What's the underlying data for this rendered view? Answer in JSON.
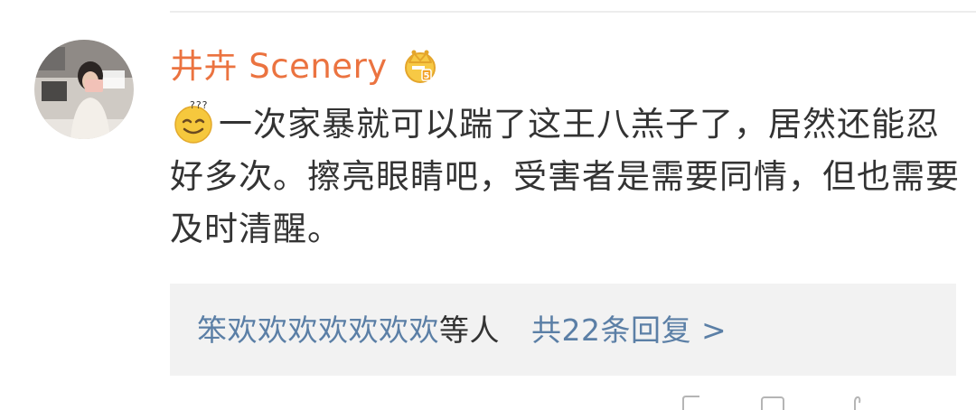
{
  "comment": {
    "username": "井卉 Scenery",
    "emoji_icon": "sweat-smile-emoji-icon",
    "text": "一次家暴就可以踹了这王八羔子了，居然还能忍好多次。擦亮眼睛吧，受害者是需要同情，但也需要及时清醒。"
  },
  "replies": {
    "users_text": "笨欢欢欢欢欢欢欢",
    "suffix_text": "等人",
    "count_text": "共22条回复",
    "chevron": ">"
  },
  "colors": {
    "username": "#eb7340",
    "link": "#5b7fa6",
    "text": "#333333",
    "reply_bg": "#f2f2f2"
  },
  "icons": {
    "avatar": "avatar",
    "badge": "crown-vip-badge-icon"
  }
}
